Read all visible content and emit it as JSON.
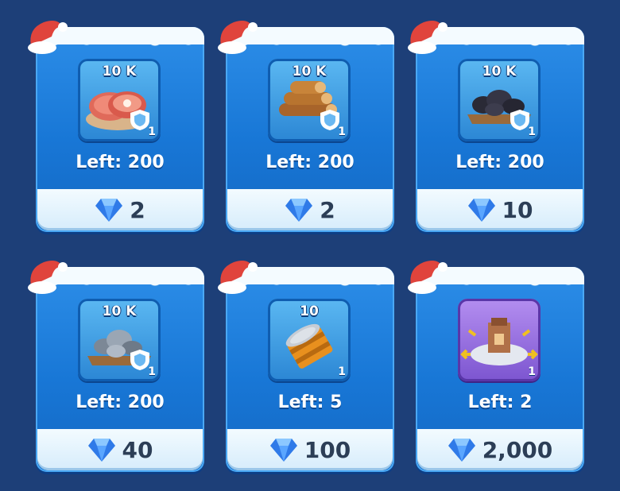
{
  "shop": {
    "items": [
      {
        "name": "meat",
        "amount": "10 K",
        "qty": "1",
        "left": "Left: 200",
        "price": "2",
        "icon": "meat-icon",
        "tile": "blue"
      },
      {
        "name": "wood",
        "amount": "10 K",
        "qty": "1",
        "left": "Left: 200",
        "price": "2",
        "icon": "wood-logs-icon",
        "tile": "blue"
      },
      {
        "name": "coal",
        "amount": "10 K",
        "qty": "1",
        "left": "Left: 200",
        "price": "10",
        "icon": "coal-icon",
        "tile": "blue"
      },
      {
        "name": "iron",
        "amount": "10 K",
        "qty": "1",
        "left": "Left: 200",
        "price": "40",
        "icon": "iron-ore-icon",
        "tile": "blue"
      },
      {
        "name": "tin-can",
        "amount": "10",
        "qty": "1",
        "left": "Left: 5",
        "price": "100",
        "icon": "tin-can-icon",
        "tile": "blue"
      },
      {
        "name": "building",
        "amount": "",
        "qty": "1",
        "left": "Left: 2",
        "price": "2,000",
        "icon": "building-move-icon",
        "tile": "purple"
      }
    ],
    "currency_icon": "gem-icon",
    "colors": {
      "background": "#1d3f78",
      "card": "#1877d6",
      "price_bg": "#e8f5fe",
      "price_text": "#2c3e56"
    }
  }
}
